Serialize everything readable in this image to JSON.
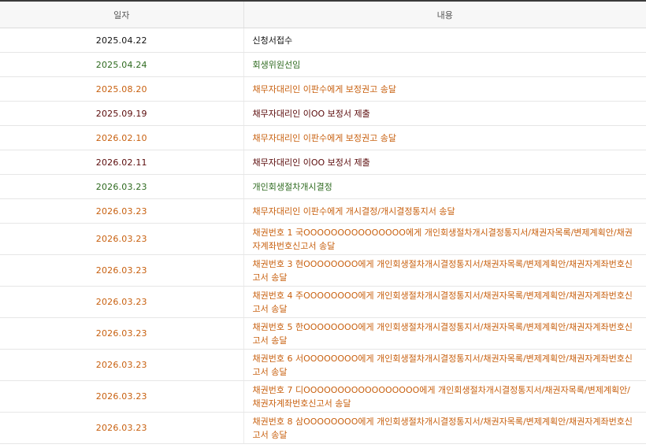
{
  "table": {
    "headers": {
      "date": "일자",
      "content": "내용"
    },
    "rows": [
      {
        "date": "2025.04.22",
        "content": "신청서접수",
        "color": "#111111"
      },
      {
        "date": "2025.04.24",
        "content": "회생위원선임",
        "color": "#2e6a1f"
      },
      {
        "date": "2025.08.20",
        "content": "채무자대리인 이판수에게 보정권고 송달",
        "color": "#c8600f"
      },
      {
        "date": "2025.09.19",
        "content": "채무자대리인 이OO 보정서 제출",
        "color": "#5a0a0a"
      },
      {
        "date": "2026.02.10",
        "content": "채무자대리인 이판수에게 보정권고 송달",
        "color": "#c8600f"
      },
      {
        "date": "2026.02.11",
        "content": "채무자대리인 이OO 보정서 제출",
        "color": "#5a0a0a"
      },
      {
        "date": "2026.03.23",
        "content": "개인회생절차개시결정",
        "color": "#2e6a1f"
      },
      {
        "date": "2026.03.23",
        "content": "채무자대리인 이판수에게 개시결정/개시결정통지서 송달",
        "color": "#c8600f"
      },
      {
        "date": "2026.03.23",
        "content": "채권번호 1 국OOOOOOOOOOOOOOO에게 개인회생절차개시결정통지서/채권자목록/변제계획안/채권자계좌번호신고서 송달",
        "color": "#c8600f"
      },
      {
        "date": "2026.03.23",
        "content": "채권번호 3 현OOOOOOOO에게 개인회생절차개시결정통지서/채권자목록/변제계획안/채권자계좌번호신고서 송달",
        "color": "#c8600f"
      },
      {
        "date": "2026.03.23",
        "content": "채권번호 4 주OOOOOOOO에게 개인회생절차개시결정통지서/채권자목록/변제계획안/채권자계좌번호신고서 송달",
        "color": "#c8600f"
      },
      {
        "date": "2026.03.23",
        "content": "채권번호 5 한OOOOOOOO에게 개인회생절차개시결정통지서/채권자목록/변제계획안/채권자계좌번호신고서 송달",
        "color": "#c8600f"
      },
      {
        "date": "2026.03.23",
        "content": "채권번호 6 서OOOOOOOO에게 개인회생절차개시결정통지서/채권자목록/변제계획안/채권자계좌번호신고서 송달",
        "color": "#c8600f"
      },
      {
        "date": "2026.03.23",
        "content": "채권번호 7 디OOOOOOOOOOOOOOOOO에게 개인회생절차개시결정통지서/채권자목록/변제계획안/채권자계좌번호신고서 송달",
        "color": "#c8600f"
      },
      {
        "date": "2026.03.23",
        "content": "채권번호 8 삼OOOOOOOO에게 개인회생절차개시결정통지서/채권자목록/변제계획안/채권자계좌번호신고서 송달",
        "color": "#c8600f"
      }
    ]
  }
}
